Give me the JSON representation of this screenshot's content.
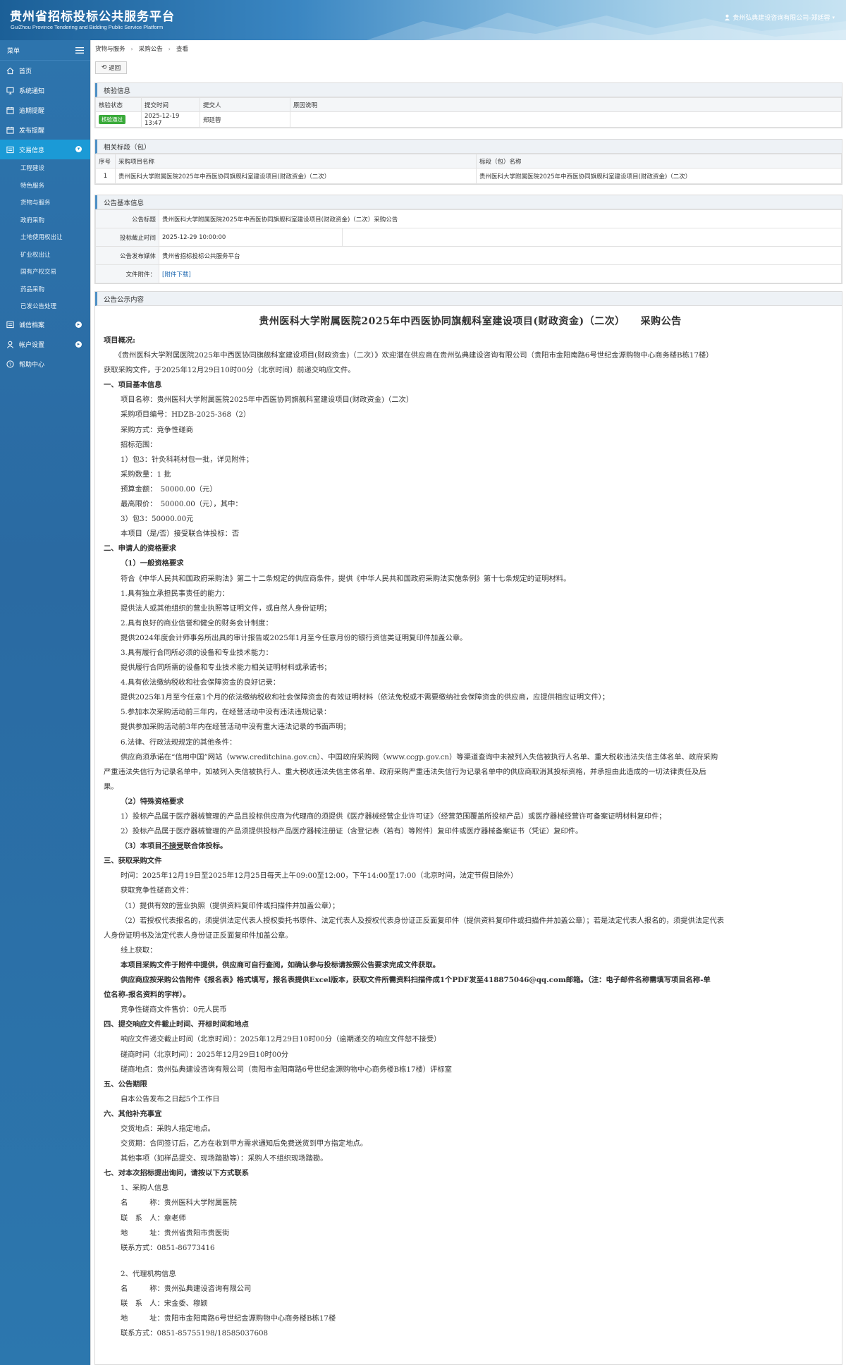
{
  "header": {
    "title_cn": "贵州省招标投标公共服务平台",
    "title_en": "GuiZhou Province Tendering and Bidding Public Service Platform",
    "user": "贵州弘典建设咨询有限公司-郑廷蓉"
  },
  "sidebar": {
    "menu_label": "菜单",
    "items": [
      {
        "label": "首页",
        "icon": "home-icon"
      },
      {
        "label": "系统通知",
        "icon": "monitor-icon"
      },
      {
        "label": "逾期提醒",
        "icon": "calendar-icon"
      },
      {
        "label": "发布提醒",
        "icon": "calendar-icon"
      },
      {
        "label": "交易信息",
        "icon": "list-icon",
        "active": true
      }
    ],
    "sub_items": [
      "工程建设",
      "特色服务",
      "货物与服务",
      "政府采购",
      "土地使用权出让",
      "矿业权出让",
      "国有产权交易",
      "药品采购",
      "已发公告处理"
    ],
    "bottom_items": [
      {
        "label": "诚信档案",
        "icon": "list-icon"
      },
      {
        "label": "帐户设置",
        "icon": "user-icon"
      },
      {
        "label": "帮助中心",
        "icon": "help-icon"
      }
    ],
    "active_color": "#1b9ad6"
  },
  "breadcrumb": [
    "货物与服务",
    "采购公告",
    "查看"
  ],
  "back_label": "返回",
  "review": {
    "title": "核验信息",
    "headers": [
      "核验状态",
      "提交时间",
      "提交人",
      "原因说明"
    ],
    "status": "核验通过",
    "time": "2025-12-19 13:47",
    "person": "郑廷蓉",
    "reason": ""
  },
  "sections": {
    "title": "相关标段（包）",
    "headers": [
      "序号",
      "采购项目名称",
      "标段（包）名称"
    ],
    "row": {
      "no": "1",
      "project": "贵州医科大学附属医院2025年中西医协同旗舰科室建设项目(财政资金)（二次）",
      "section": "贵州医科大学附属医院2025年中西医协同旗舰科室建设项目(财政资金)（二次）"
    }
  },
  "basic": {
    "title": "公告基本信息",
    "rows": [
      {
        "label": "公告标题",
        "value": "贵州医科大学附属医院2025年中西医协同旗舰科室建设项目(财政资金)（二次）采购公告"
      },
      {
        "label": "投标截止时间",
        "value": "2025-12-29 10:00:00"
      },
      {
        "label": "公告发布媒体",
        "value": "贵州省招标投标公共服务平台"
      },
      {
        "label": "文件附件：",
        "value": "[附件下载]"
      }
    ]
  },
  "content": {
    "panel_title": "公告公示内容",
    "doc_title": "贵州医科大学附属医院2025年中西医协同旗舰科室建设项目(财政资金)（二次）　　采购公告",
    "lines": [
      {
        "t": "项目概况:",
        "c": "b"
      },
      {
        "t": "　　《贵州医科大学附属医院2025年中西医协同旗舰科室建设项目(财政资金)（二次）》欢迎潜在供应商在贵州弘典建设咨询有限公司（贵阳市金阳南路6号世纪金源购物中心商务楼B栋17楼）",
        "c": ""
      },
      {
        "t": "获取采购文件，于2025年12月29日10时00分（北京时间）前递交响应文件。",
        "c": ""
      },
      {
        "t": "一、项目基本信息",
        "c": "b"
      },
      {
        "t": "项目名称：贵州医科大学附属医院2025年中西医协同旗舰科室建设项目(财政资金)（二次）",
        "c": "i1"
      },
      {
        "t": "采购项目编号：HDZB-2025-368（2）",
        "c": "i1"
      },
      {
        "t": "采购方式：竞争性磋商",
        "c": "i1"
      },
      {
        "t": "招标范围：",
        "c": "i1"
      },
      {
        "t": "1）包3：针灸科耗材包一批，详见附件；",
        "c": "i1"
      },
      {
        "t": "采购数量：1 批",
        "c": "i1"
      },
      {
        "t": "预算金额：　50000.00（元）",
        "c": "i1"
      },
      {
        "t": "最高限价：　50000.00（元），其中：",
        "c": "i1"
      },
      {
        "t": "3）包3：50000.00元",
        "c": "i1"
      },
      {
        "t": "本项目（是/否）接受联合体投标：否",
        "c": "i1"
      },
      {
        "t": "二、申请人的资格要求",
        "c": "b"
      },
      {
        "t": "（1）一般资格要求",
        "c": "b i1"
      },
      {
        "t": "符合《中华人民共和国政府采购法》第二十二条规定的供应商条件，提供《中华人民共和国政府采购法实施条例》第十七条规定的证明材料。",
        "c": "i1"
      },
      {
        "t": "1.具有独立承担民事责任的能力：",
        "c": "i1"
      },
      {
        "t": "提供法人或其他组织的营业执照等证明文件，或自然人身份证明；",
        "c": "i1"
      },
      {
        "t": "2.具有良好的商业信誉和健全的财务会计制度：",
        "c": "i1"
      },
      {
        "t": "提供2024年度会计师事务所出具的审计报告或2025年1月至今任意月份的银行资信类证明复印件加盖公章。",
        "c": "i1"
      },
      {
        "t": "3.具有履行合同所必须的设备和专业技术能力：",
        "c": "i1"
      },
      {
        "t": "提供履行合同所需的设备和专业技术能力相关证明材料或承诺书；",
        "c": "i1"
      },
      {
        "t": "4.具有依法缴纳税收和社会保障资金的良好记录：",
        "c": "i1"
      },
      {
        "t": "提供2025年1月至今任意1个月的依法缴纳税收和社会保障资金的有效证明材料（依法免税或不需要缴纳社会保障资金的供应商，应提供相应证明文件）；",
        "c": "i1"
      },
      {
        "t": "5.参加本次采购活动前三年内，在经营活动中没有违法违规记录：",
        "c": "i1"
      },
      {
        "t": "提供参加采购活动前3年内在经营活动中没有重大违法记录的书面声明；",
        "c": "i1"
      },
      {
        "t": "6.法律、行政法规规定的其他条件：",
        "c": "i1"
      },
      {
        "t": "供应商须承诺在“信用中国”网站（www.creditchina.gov.cn）、中国政府采购网（www.ccgp.gov.cn）等渠道查询中未被列入失信被执行人名单、重大税收违法失信主体名单、政府采购",
        "c": "i1"
      },
      {
        "t": "严重违法失信行为记录名单中，如被列入失信被执行人、重大税收违法失信主体名单、政府采购严重违法失信行为记录名单中的供应商取消其投标资格，并承担由此造成的一切法律责任及后",
        "c": ""
      },
      {
        "t": "果。",
        "c": ""
      },
      {
        "t": "（2）特殊资格要求",
        "c": "b i1"
      },
      {
        "t": "1）投标产品属于医疗器械管理的产品且投标供应商为代理商的须提供《医疗器械经营企业许可证》（经营范围覆盖所投标产品）或医疗器械经营许可备案证明材料复印件；",
        "c": "i1"
      },
      {
        "t": "2）投标产品属于医疗器械管理的产品须提供投标产品医疗器械注册证（含登记表（若有）等附件）复印件或医疗器械备案证书（凭证）复印件。",
        "c": "i1"
      },
      {
        "t": "（3）本项目不接受联合体投标。",
        "c": "b i1"
      },
      {
        "t": "三、获取采购文件",
        "c": "b"
      },
      {
        "t": "时间：2025年12月19日至2025年12月25日每天上午09:00至12:00，下午14:00至17:00（北京时间，法定节假日除外）",
        "c": "i1"
      },
      {
        "t": "获取竞争性磋商文件：",
        "c": "i1"
      },
      {
        "t": "（1）提供有效的营业执照（提供资料复印件或扫描件并加盖公章）；",
        "c": "i1"
      },
      {
        "t": "（2）若授权代表报名的，须提供法定代表人授权委托书原件、法定代表人及授权代表身份证正反面复印件（提供资料复印件或扫描件并加盖公章）；若是法定代表人报名的，须提供法定代表",
        "c": "i1"
      },
      {
        "t": "人身份证明书及法定代表人身份证正反面复印件加盖公章。",
        "c": ""
      },
      {
        "t": "线上获取：",
        "c": "i1"
      },
      {
        "t": "本项目采购文件于附件中提供，供应商可自行查阅，如确认参与投标请按照公告要求完成文件获取。",
        "c": "b i1"
      },
      {
        "t": "供应商应按采购公告附件《报名表》格式填写，报名表提供Excel版本，获取文件所需资料扫描件成1个PDF发至418875046@qq.com邮箱。（注：电子邮件名称需填写项目名称-单",
        "c": "b i1"
      },
      {
        "t": "位名称-报名资料的字样）。",
        "c": "b"
      },
      {
        "t": "竞争性磋商文件售价：0元人民币",
        "c": "i1"
      },
      {
        "t": "四、提交响应文件截止时间、开标时间和地点",
        "c": "b"
      },
      {
        "t": "响应文件递交截止时间（北京时间）：2025年12月29日10时00分（逾期递交的响应文件恕不接受）",
        "c": "i1"
      },
      {
        "t": "磋商时间（北京时间）：2025年12月29日10时00分",
        "c": "i1"
      },
      {
        "t": "磋商地点：贵州弘典建设咨询有限公司（贵阳市金阳南路6号世纪金源购物中心商务楼B栋17楼）评标室",
        "c": "i1"
      },
      {
        "t": "五、公告期限",
        "c": "b"
      },
      {
        "t": "自本公告发布之日起5个工作日",
        "c": "i1"
      },
      {
        "t": "六、其他补充事宜",
        "c": "b"
      },
      {
        "t": "交货地点：采购人指定地点。",
        "c": "i1"
      },
      {
        "t": "交货期：合同签订后，乙方在收到甲方需求通知后免费送货到甲方指定地点。",
        "c": "i1"
      },
      {
        "t": "其他事项（如样品提交、现场踏勘等）：采购人不组织现场踏勘。",
        "c": "i1"
      },
      {
        "t": "七、对本次招标提出询问，请按以下方式联系",
        "c": "b"
      },
      {
        "t": "1、采购人信息",
        "c": "i1"
      },
      {
        "t": "名　　　称：贵州医科大学附属医院",
        "c": "i1"
      },
      {
        "t": "联　系　人：章老师",
        "c": "i1"
      },
      {
        "t": "地　　　址：贵州省贵阳市贵医街",
        "c": "i1"
      },
      {
        "t": "联系方式：0851-86773416",
        "c": "i1"
      },
      {
        "t": "",
        "c": "gap"
      },
      {
        "t": "2、代理机构信息",
        "c": "i1"
      },
      {
        "t": "名　　　称：贵州弘典建设咨询有限公司",
        "c": "i1"
      },
      {
        "t": "联　系　人：宋金委、穆颖",
        "c": "i1"
      },
      {
        "t": "地　　　址：贵阳市金阳南路6号世纪金源购物中心商务楼B栋17楼",
        "c": "i1"
      },
      {
        "t": "联系方式：0851-85755198/18585037608",
        "c": "i1"
      }
    ]
  }
}
